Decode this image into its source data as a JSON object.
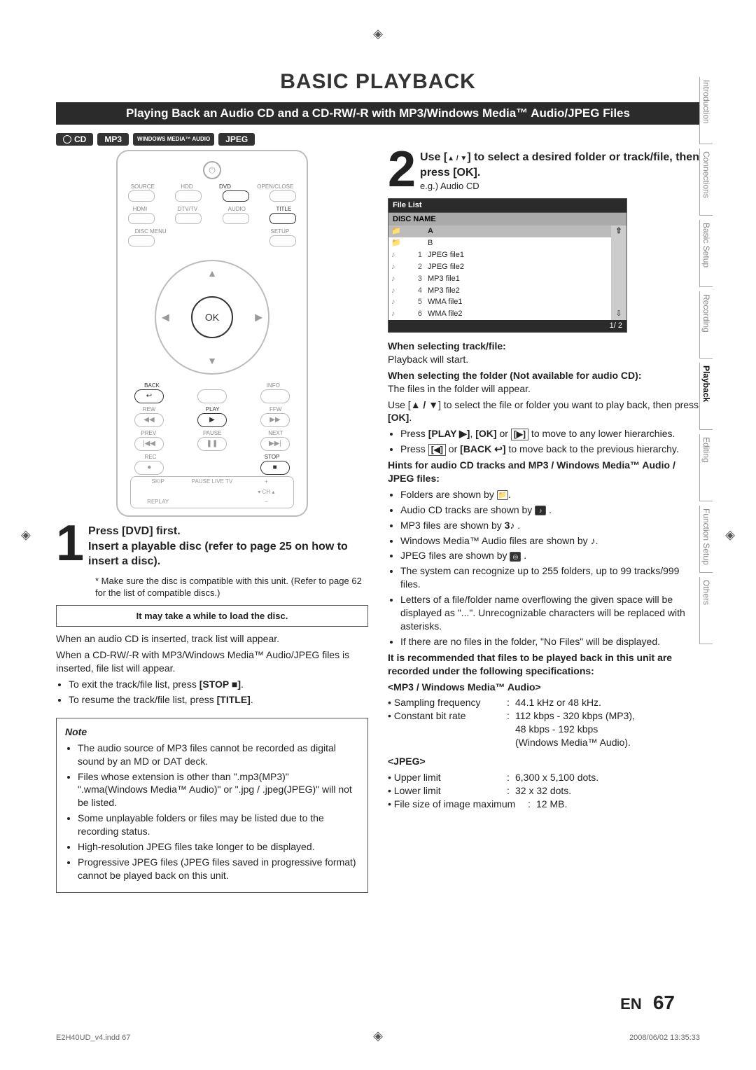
{
  "chapter": "BASIC PLAYBACK",
  "banner": "Playing Back an Audio CD and a CD-RW/-R with MP3/Windows Media™ Audio/JPEG Files",
  "badges": {
    "cd": "CD",
    "mp3": "MP3",
    "wma": "WINDOWS MEDIA™ AUDIO",
    "jpeg": "JPEG"
  },
  "tabs": [
    "Introduction",
    "Connections",
    "Basic Setup",
    "Recording",
    "Playback",
    "Editing",
    "Function Setup",
    "Others"
  ],
  "active_tab": "Playback",
  "remote": {
    "power": "⏻",
    "row1_labels": [
      "SOURCE",
      "HDD",
      "DVD",
      "OPEN/CLOSE"
    ],
    "row2_labels": [
      "HDMI",
      "DTV/TV",
      "AUDIO",
      "TITLE"
    ],
    "row3_labels": [
      "DISC MENU",
      "",
      "",
      "SETUP"
    ],
    "ok": "OK",
    "row4_labels": [
      "BACK",
      "",
      "INFO"
    ],
    "row5_labels": [
      "REW",
      "PLAY",
      "FFW"
    ],
    "row6_labels": [
      "PREV",
      "PAUSE",
      "NEXT"
    ],
    "row7_labels": [
      "REC",
      "",
      "STOP"
    ],
    "bigpad_left_top": "SKIP",
    "bigpad_left_bot": "REPLAY",
    "bigpad_mid": "PAUSE LIVE TV",
    "bigpad_right_top": "+",
    "bigpad_right_mid": "▾ CH ▴",
    "bigpad_right_bot": "−",
    "back_icon": "↩",
    "play": "▶",
    "rew": "◀◀",
    "ffw": "▶▶",
    "prev": "|◀◀",
    "pause": "❚❚",
    "next": "▶▶|",
    "rec": "●",
    "stop": "■",
    "stopbox": "■"
  },
  "step1": {
    "num": "1",
    "line_a": "Press [DVD] first.",
    "line_b": "Insert a playable disc (refer to page 25 on how to insert a disc).",
    "foot": "* Make sure the disc is compatible with this unit. (Refer to page 62 for the list of compatible discs.)",
    "loadbox": "It may take a while to load the disc.",
    "p1": "When an audio CD is inserted, track list will appear.",
    "p2": "When a CD-RW/-R with MP3/Windows Media™ Audio/JPEG files is inserted, file list will appear.",
    "li1a": "To exit the track/file list, press ",
    "li1b": "[STOP ■]",
    "li1c": ".",
    "li2a": "To resume the track/file list, press ",
    "li2b": "[TITLE]",
    "li2c": "."
  },
  "note": {
    "head": "Note",
    "items": [
      "The audio source of MP3 files cannot be recorded as digital sound by an MD or DAT deck.",
      "Files whose extension is other than \".mp3(MP3)\" \".wma(Windows Media™ Audio)\" or \".jpg / .jpeg(JPEG)\" will not be listed.",
      "Some unplayable folders or files may be listed due to the recording status.",
      "High-resolution JPEG files take longer to be displayed.",
      "Progressive JPEG files (JPEG files saved in progressive format) cannot be played back on this unit."
    ]
  },
  "step2": {
    "num": "2",
    "head_a": "Use [",
    "head_b": "▲ / ▼",
    "head_c": "] to select a desired folder or track/file, then press [OK].",
    "eg": "e.g.) Audio CD",
    "screen": {
      "title": "File List",
      "disc_name": "DISC NAME",
      "rows": [
        {
          "ic": "📁",
          "n": "",
          "t": "A"
        },
        {
          "ic": "📁",
          "n": "",
          "t": "B"
        },
        {
          "ic": "♪",
          "n": "1",
          "t": "JPEG file1"
        },
        {
          "ic": "♪",
          "n": "2",
          "t": "JPEG file2"
        },
        {
          "ic": "♪",
          "n": "3",
          "t": "MP3 file1"
        },
        {
          "ic": "♪",
          "n": "4",
          "t": "MP3 file2"
        },
        {
          "ic": "♪",
          "n": "5",
          "t": "WMA file1"
        },
        {
          "ic": "♪",
          "n": "6",
          "t": "WMA file2"
        }
      ],
      "scroll_up": "⇧",
      "scroll_dn": "⇩",
      "pager": "1/ 2"
    },
    "sel_track_h": "When selecting track/file:",
    "sel_track_t": "Playback will start.",
    "sel_folder_h": "When selecting the folder (Not available for audio CD):",
    "sel_folder_t": "The files in the folder will appear.",
    "sel_nav_a": "Use [",
    "sel_nav_b": "▲ / ▼",
    "sel_nav_c": "] to select the file or folder you want to play back, then press ",
    "sel_nav_d": "[OK]",
    "sel_nav_e": ".",
    "nav1a": "Press ",
    "nav1b": "[PLAY ▶]",
    "nav1c": ", ",
    "nav1d": "[OK]",
    "nav1e": " or ",
    "nav1f": "[▶]",
    "nav1g": " to move to any lower hierarchies.",
    "nav2a": "Press ",
    "nav2b": "[◀]",
    "nav2c": " or ",
    "nav2d": "[BACK ↩]",
    "nav2e": " to move back to the previous hierarchy.",
    "hints_h": "Hints for audio CD tracks and MP3 / Windows Media™ Audio / JPEG files:",
    "hint_folder": "Folders are shown by ",
    "hint_cd": "Audio CD tracks are shown by ",
    "hint_mp3a": "MP3 files are shown by ",
    "hint_mp3b": "3♪",
    "hint_wmaa": "Windows Media™ Audio files are shown by ",
    "hint_wmab": "♪",
    "hint_jpeg": "JPEG files are shown by ",
    "hint_limit": "The system can recognize up to 255 folders, up to 99 tracks/999 files.",
    "hint_overflow": "Letters of a file/folder name overflowing the given space will be displayed as \"...\". Unrecognizable characters will be replaced with asterisks.",
    "hint_nofiles": "If there are no files in the folder, \"No Files\" will be displayed.",
    "rec_h": "It is recommended that files to be played back in this unit are recorded under the following specifications:",
    "spec_mp3_h": "<MP3 / Windows Media™ Audio>",
    "spec_sf_k": "Sampling frequency",
    "spec_sf_v": "44.1 kHz or 48 kHz.",
    "spec_br_k": "Constant bit rate",
    "spec_br_v1": "112 kbps - 320 kbps (MP3),",
    "spec_br_v2": "48 kbps - 192 kbps",
    "spec_br_v3": "(Windows Media™ Audio).",
    "spec_jpeg_h": "<JPEG>",
    "spec_ul_k": "Upper limit",
    "spec_ul_v": "6,300 x 5,100 dots.",
    "spec_ll_k": "Lower limit",
    "spec_ll_v": "32 x 32 dots.",
    "spec_fs_k": "File size of image maximum",
    "spec_fs_v": "12 MB."
  },
  "pager": {
    "lang": "EN",
    "num": "67"
  },
  "footer": {
    "left": "E2H40UD_v4.indd   67",
    "right": "2008/06/02   13:35:33"
  }
}
